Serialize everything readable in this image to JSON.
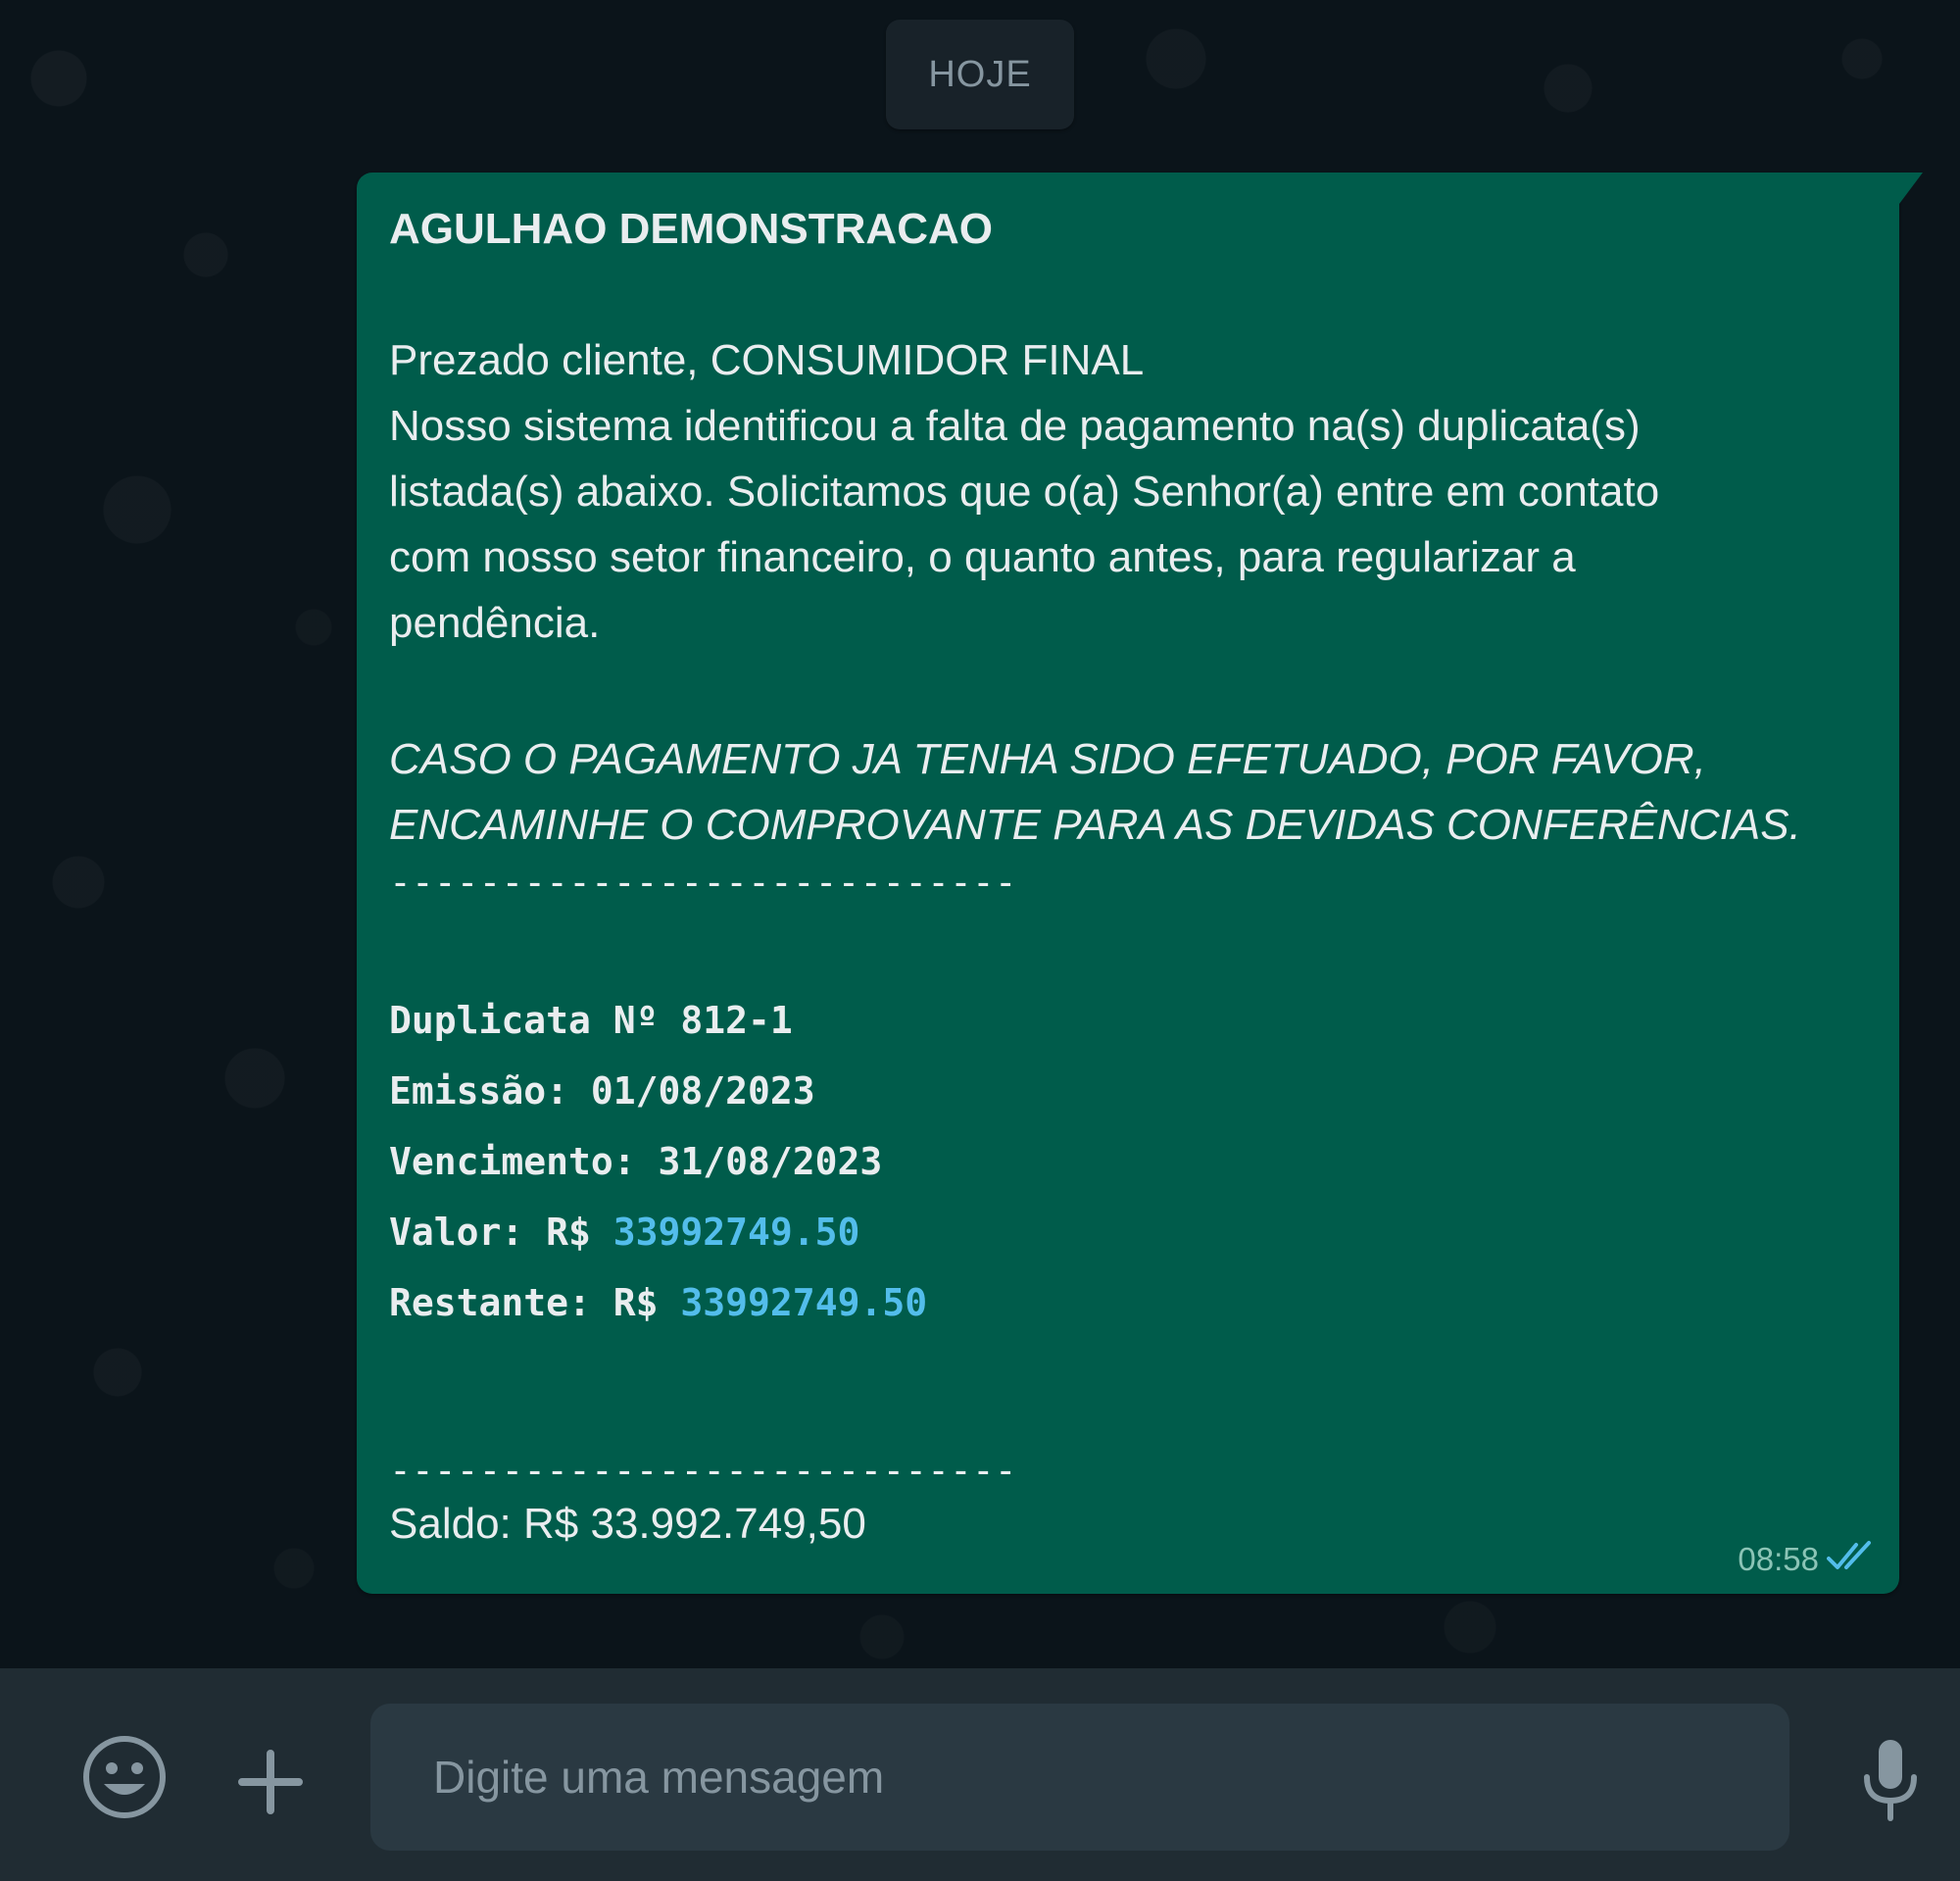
{
  "date_chip": "HOJE",
  "message": {
    "title": "AGULHAO DEMONSTRACAO",
    "greeting": "Prezado cliente, CONSUMIDOR FINAL",
    "body_lines": [
      "Nosso sistema identificou a falta de pagamento na(s) duplicata(s)",
      "listada(s) abaixo. Solicitamos que o(a) Senhor(a) entre em contato",
      "com nosso setor financeiro, o quanto antes, para regularizar a",
      "pendência."
    ],
    "notice_lines": [
      "CASO O PAGAMENTO JA TENHA SIDO EFETUADO, POR FAVOR,",
      "ENCAMINHE O COMPROVANTE PARA AS DEVIDAS CONFERÊNCIAS."
    ],
    "separator": "----------------------------",
    "duplicata": "Duplicata Nº 812-1",
    "emissao": "Emissão: 01/08/2023",
    "vencimento": "Vencimento: 31/08/2023",
    "valor_label": "Valor: R$ ",
    "valor_value": "33992749.50",
    "restante_label": "Restante: R$ ",
    "restante_value": "33992749.50",
    "saldo": "Saldo: R$ 33.992.749,50",
    "time": "08:58",
    "status_icon": "double-check-icon",
    "link_color": "#53bdeb"
  },
  "composer": {
    "placeholder": "Digite uma mensagem",
    "value": "",
    "emoji_icon": "emoji-icon",
    "attach_icon": "plus-icon",
    "mic_icon": "microphone-icon"
  }
}
